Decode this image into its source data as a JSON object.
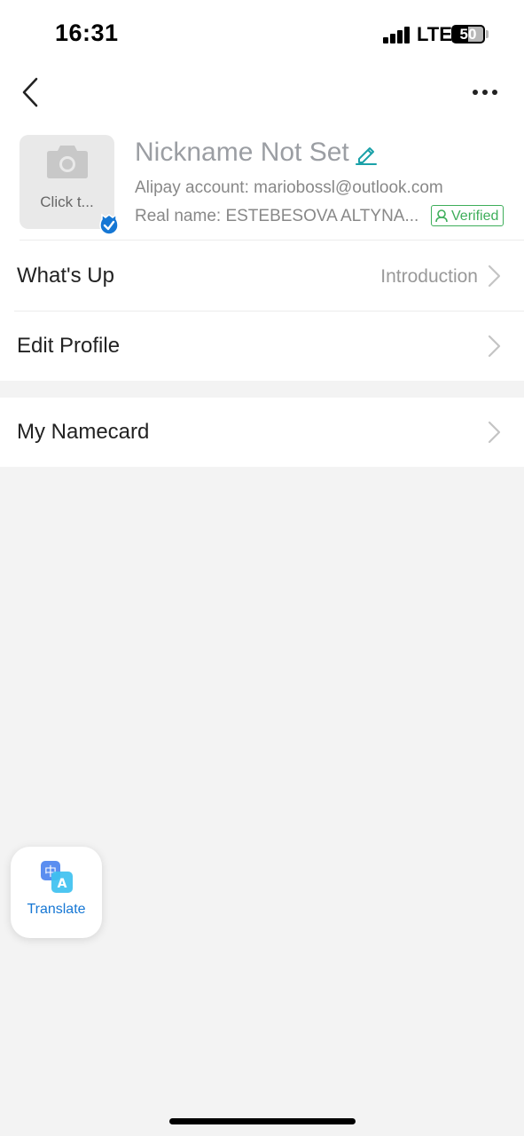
{
  "status_bar": {
    "time": "16:31",
    "network": "LTE",
    "battery_level": "50",
    "battery_fraction": 0.5
  },
  "nav": {
    "back_icon": "chevron-left-icon",
    "more_icon": "more-horizontal-icon"
  },
  "profile": {
    "avatar_label": "Click t...",
    "avatar_icon": "camera-icon",
    "nickname": "Nickname Not Set",
    "account_line": "Alipay account: mariobossl@outlook.com",
    "realname_line": "Real name: ESTEBESOVA ALTYNA...",
    "verified_label": "Verified",
    "verified_color": "#3eae5a"
  },
  "rows": [
    {
      "label": "What's Up",
      "value": "Introduction"
    },
    {
      "label": "Edit Profile",
      "value": ""
    },
    {
      "label": "My Namecard",
      "value": ""
    }
  ],
  "translate": {
    "label": "Translate",
    "icon": "translate-icon",
    "accent": "#1677d4"
  }
}
